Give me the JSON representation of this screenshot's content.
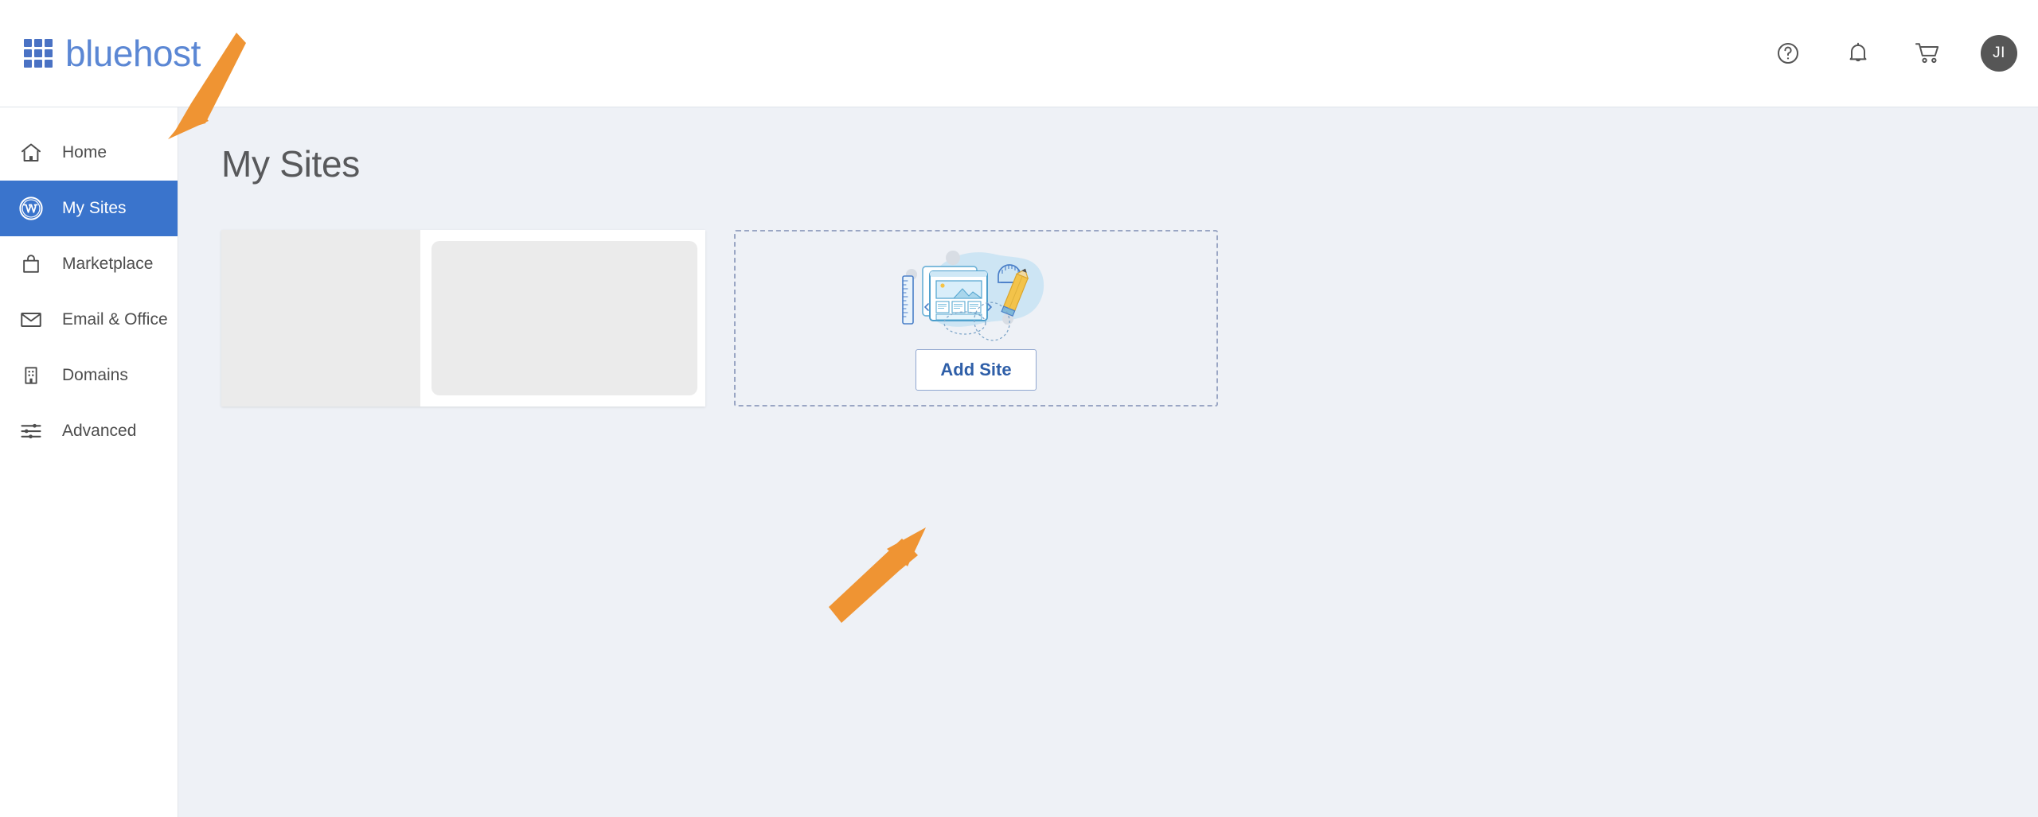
{
  "header": {
    "brand_name": "bluehost",
    "logo_icon": "grid-icon",
    "actions": [
      {
        "name": "help-icon",
        "label": "Help"
      },
      {
        "name": "bell-icon",
        "label": "Notifications"
      },
      {
        "name": "cart-icon",
        "label": "Cart"
      }
    ],
    "avatar_initials": "JI"
  },
  "sidebar": {
    "items": [
      {
        "label": "Home",
        "icon": "home-icon",
        "active": false
      },
      {
        "label": "My Sites",
        "icon": "wordpress-icon",
        "active": true
      },
      {
        "label": "Marketplace",
        "icon": "shopping-bag-icon",
        "active": false
      },
      {
        "label": "Email & Office",
        "icon": "envelope-icon",
        "active": false
      },
      {
        "label": "Domains",
        "icon": "building-icon",
        "active": false
      },
      {
        "label": "Advanced",
        "icon": "sliders-icon",
        "active": false
      }
    ]
  },
  "main": {
    "page_title": "My Sites",
    "site_card": {
      "state": "loading-skeleton"
    },
    "add_site_card": {
      "button_label": "Add Site",
      "illustration": "website-builder-illustration"
    }
  },
  "annotations": {
    "color": "#ef9433",
    "arrows": [
      {
        "name": "arrow-to-my-sites",
        "points_at": "sidebar-item-my-sites"
      },
      {
        "name": "arrow-to-add-site",
        "points_at": "add-site-button"
      }
    ]
  },
  "colors": {
    "brand_blue": "#5b87d4",
    "active_nav": "#3a74cc",
    "page_bg": "#eef1f6",
    "accent_orange": "#ef9433",
    "button_text": "#2f5fa8"
  }
}
